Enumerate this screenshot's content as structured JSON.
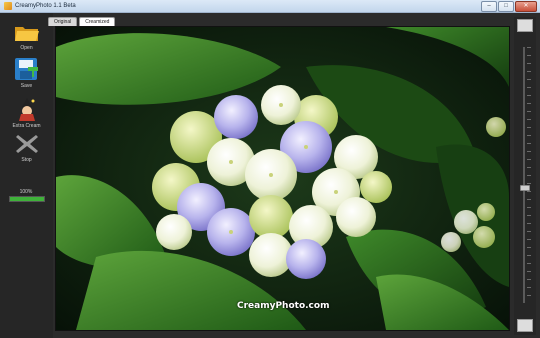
{
  "window": {
    "title": "CreamyPhoto 1.1 Beta"
  },
  "toolbar": {
    "open_label": "Open",
    "save_label": "Save",
    "extra_creamy_label": "Extra Cream",
    "stop_label": "Stop",
    "progress_text": "100%",
    "progress_value": 1.0
  },
  "tabs": [
    {
      "label": "Original"
    },
    {
      "label": "Creamized"
    }
  ],
  "viewer": {
    "watermark": "CreamyPhoto.com"
  },
  "slider": {
    "value": 0.55
  },
  "colors": {
    "progress": "#3fb23a",
    "background": "#2b2b2b"
  }
}
